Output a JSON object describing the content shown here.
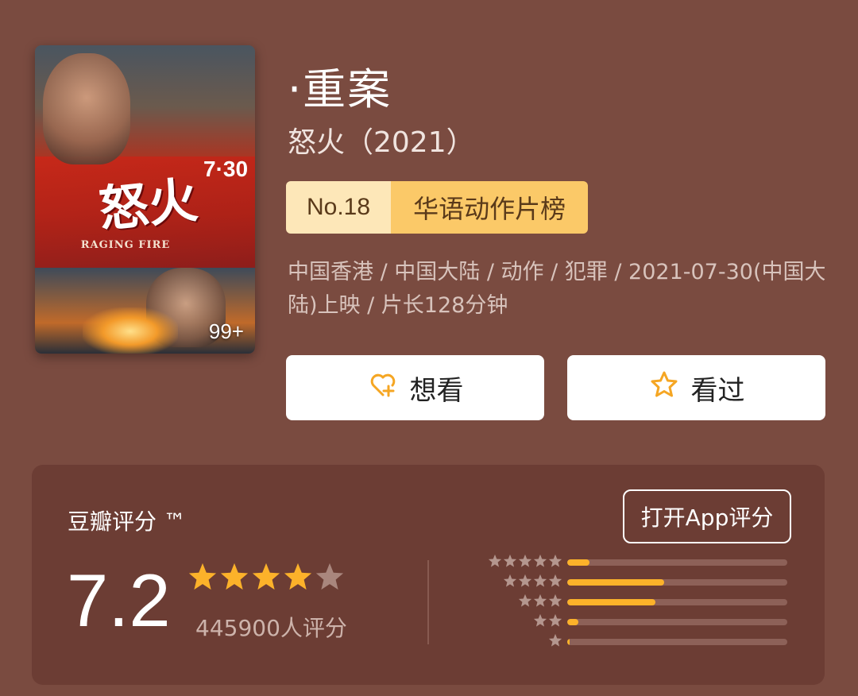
{
  "poster": {
    "title_cn": "怒火",
    "date_text": "7·30",
    "title_en": "RAGING FIRE",
    "badge": "99+"
  },
  "movie": {
    "title": "·重案",
    "subtitle": "怒火（2021）",
    "rank_no": "No.18",
    "rank_list": "华语动作片榜",
    "meta": "中国香港 / 中国大陆 / 动作 / 犯罪 / 2021-07-30(中国大陆)上映 / 片长128分钟"
  },
  "actions": {
    "want_label": "想看",
    "seen_label": "看过",
    "want_icon": "heart-plus-icon",
    "seen_icon": "star-outline-icon"
  },
  "rating": {
    "label": "豆瓣评分 ™",
    "open_app_label": "打开App评分",
    "score": "7.2",
    "stars_filled": 4,
    "stars_total": 5,
    "count_text": "445900人评分",
    "distribution": [
      {
        "stars": 5,
        "fraction": 0.1
      },
      {
        "stars": 4,
        "fraction": 0.44
      },
      {
        "stars": 3,
        "fraction": 0.4
      },
      {
        "stars": 2,
        "fraction": 0.05
      },
      {
        "stars": 1,
        "fraction": 0.01
      }
    ],
    "colors": {
      "accent": "#fcb22a",
      "track": "#8d6158",
      "card": "#6c3d34",
      "background": "#7a4b40"
    }
  }
}
